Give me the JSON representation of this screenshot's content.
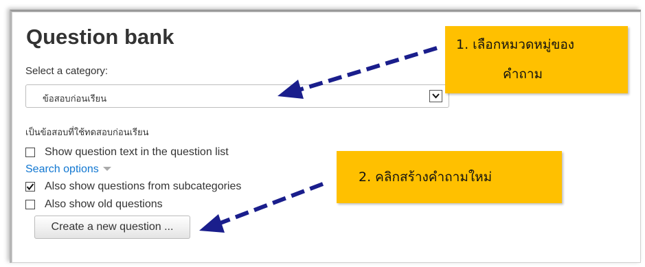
{
  "page": {
    "title": "Question bank",
    "select_label": "Select a category:",
    "selected_category": "ข้อสอบก่อนเรียน",
    "category_info": "เป็นข้อสอบที่ใช้ทดสอบก่อนเรียน",
    "show_question_text": {
      "label": "Show question text in the question list",
      "checked": false
    },
    "search_options_label": "Search options",
    "show_subcategories": {
      "label": "Also show questions from subcategories",
      "checked": true
    },
    "show_old_questions": {
      "label": "Also show old questions",
      "checked": false
    },
    "create_button_label": "Create a new question ..."
  },
  "callouts": {
    "first": {
      "line1": "1. เลือกหมวดหมู่ของ",
      "line2": "คำถาม"
    },
    "second": {
      "line1": "2. คลิกสร้างคำถามใหม่"
    }
  },
  "colors": {
    "callout_background": "#ffc000",
    "arrow": "#1a1e8c",
    "link": "#1177d1",
    "text": "#333333"
  },
  "icons": [
    "dropdown-arrow-icon",
    "checkmark-icon",
    "caret-down-icon",
    "arrow-icon"
  ]
}
